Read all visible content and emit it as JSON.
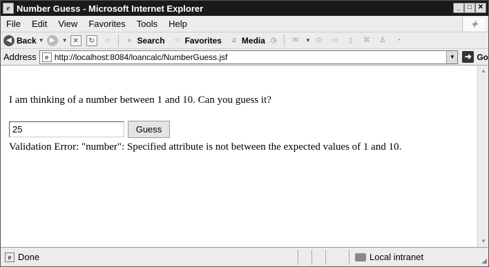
{
  "window": {
    "title": "Number Guess - Microsoft Internet Explorer",
    "controls": [
      "_",
      "□",
      "✕"
    ]
  },
  "menubar": {
    "items": [
      "File",
      "Edit",
      "View",
      "Favorites",
      "Tools",
      "Help"
    ]
  },
  "toolbar": {
    "back_label": "Back",
    "search_label": "Search",
    "favorites_label": "Favorites",
    "media_label": "Media"
  },
  "addressbar": {
    "label": "Address",
    "url": "http://localhost:8084/loancalc/NumberGuess.jsf",
    "go_label": "Go"
  },
  "page": {
    "prompt": "I am thinking of a number between 1 and 10. Can you guess it?",
    "input_value": "25",
    "button_label": "Guess",
    "error": "Validation Error: \"number\": Specified attribute is not between the expected values of 1 and 10."
  },
  "statusbar": {
    "status": "Done",
    "zone": "Local intranet"
  }
}
